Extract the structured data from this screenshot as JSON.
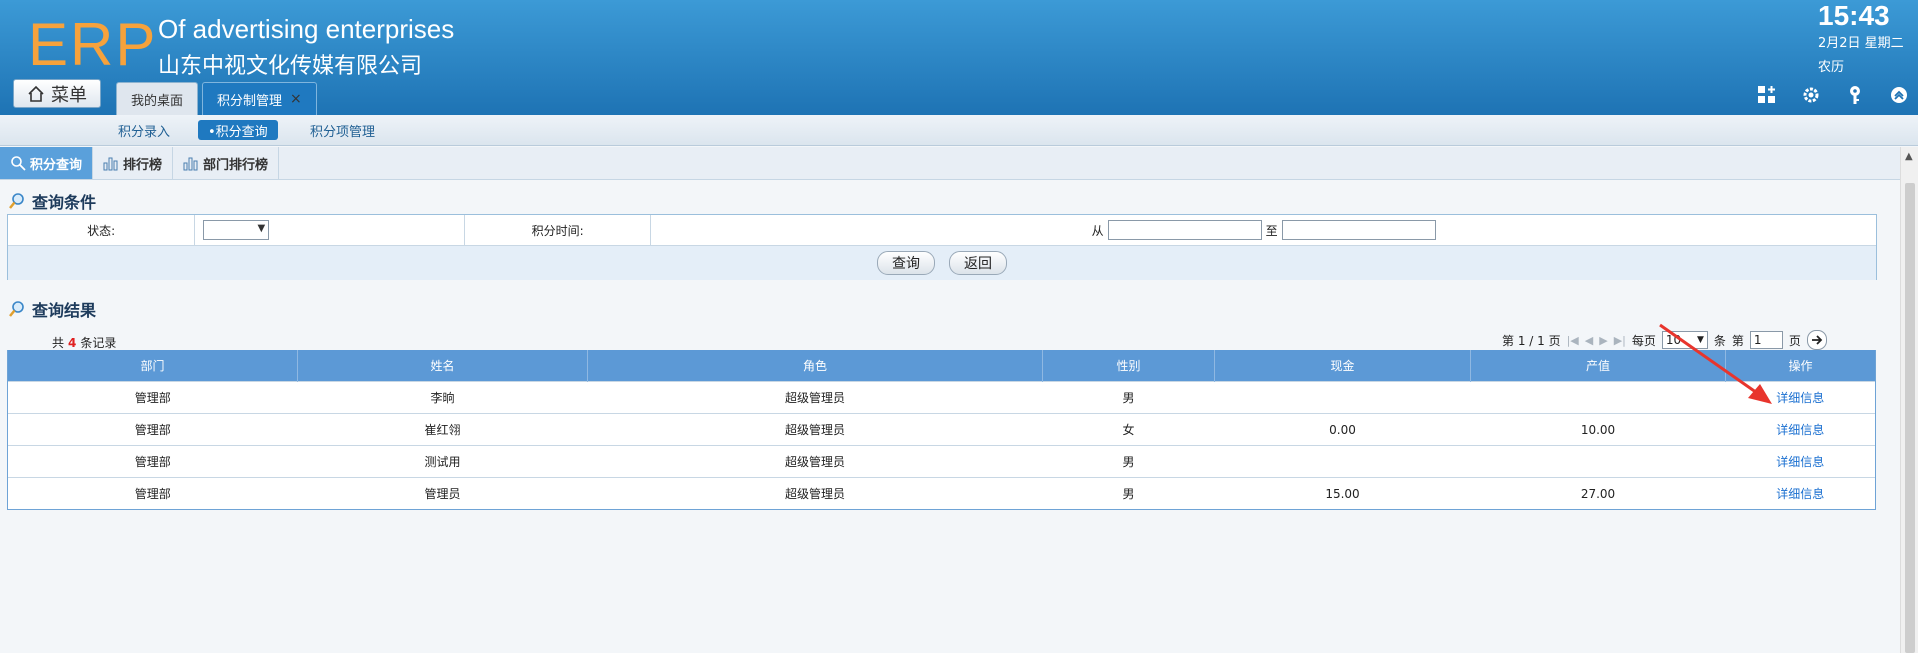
{
  "header": {
    "logo": "ERP",
    "title_en": "Of advertising enterprises",
    "title_cn": "山东中视文化传媒有限公司",
    "menu_label": "菜单",
    "time": "15:43",
    "date": "2月2日 星期二",
    "lunar": "农历",
    "icons": [
      "grid-plus-icon",
      "gear-icon",
      "key-icon",
      "chevron-up-circle-icon"
    ]
  },
  "top_tabs": [
    {
      "label": "我的桌面",
      "active": false
    },
    {
      "label": "积分制管理",
      "active": true,
      "close": "×"
    }
  ],
  "subnav": [
    {
      "label": "积分录入",
      "active": false
    },
    {
      "label": "•积分查询",
      "active": true
    },
    {
      "label": "积分项管理",
      "active": false
    }
  ],
  "inner_tabs": [
    {
      "label": "积分查询",
      "icon": "search-icon",
      "active": true
    },
    {
      "label": "排行榜",
      "icon": "bar-chart-icon",
      "active": false
    },
    {
      "label": "部门排行榜",
      "icon": "bar-chart-icon",
      "active": false
    }
  ],
  "query": {
    "title": "查询条件",
    "status_label": "状态:",
    "status_value": "",
    "time_label": "积分时间:",
    "from_label": "从",
    "to_label": "至",
    "from_value": "",
    "to_value": "",
    "search_button": "查询",
    "back_button": "返回"
  },
  "results": {
    "title": "查询结果",
    "count_prefix": "共",
    "count": "4",
    "count_suffix": "条记录",
    "pager": {
      "page_info": "第 1 / 1 页",
      "per_page_label": "每页",
      "per_page_value": "10",
      "unit": "条",
      "page_label": "第",
      "page_value": "1",
      "page_suffix": "页"
    },
    "columns": [
      "部门",
      "姓名",
      "角色",
      "性别",
      "现金",
      "产值",
      "操作"
    ],
    "rows": [
      [
        "管理部",
        "李晌",
        "超级管理员",
        "男",
        "",
        "",
        "详细信息"
      ],
      [
        "管理部",
        "崔红翎",
        "超级管理员",
        "女",
        "0.00",
        "10.00",
        "详细信息"
      ],
      [
        "管理部",
        "测试用",
        "超级管理员",
        "男",
        "",
        "",
        "详细信息"
      ],
      [
        "管理部",
        "管理员",
        "超级管理员",
        "男",
        "15.00",
        "27.00",
        "详细信息"
      ]
    ]
  },
  "colors": {
    "header_top": "#3c9ad6",
    "header_bottom": "#1e73b4",
    "logo": "#f6a23c",
    "table_header": "#5c99d6",
    "link": "#1a6fd0",
    "arrow": "#e8352d"
  }
}
